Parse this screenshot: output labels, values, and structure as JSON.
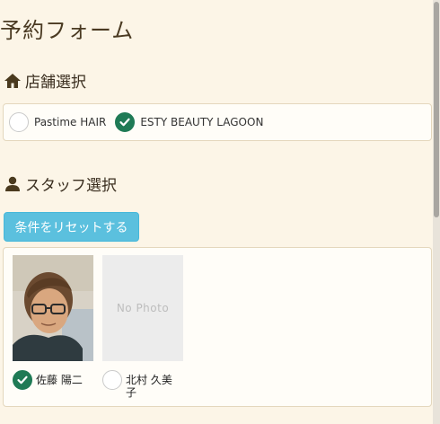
{
  "page": {
    "title": "予約フォーム"
  },
  "store_section": {
    "heading": "店舗選択",
    "icon": "home-icon",
    "options": [
      {
        "label": "Pastime HAIR",
        "selected": false
      },
      {
        "label": "ESTY BEAUTY LAGOON",
        "selected": true
      }
    ]
  },
  "staff_section": {
    "heading": "スタッフ選択",
    "icon": "user-icon",
    "reset_label": "条件をリセットする",
    "staff": [
      {
        "name": "佐藤 陽二",
        "selected": true,
        "photo": "portrait"
      },
      {
        "name": "北村 久美子",
        "selected": false,
        "photo_placeholder": "No Photo"
      }
    ]
  },
  "colors": {
    "background": "#fcf5e7",
    "check_green": "#1f7a55",
    "reset_button": "#5bc0de"
  }
}
